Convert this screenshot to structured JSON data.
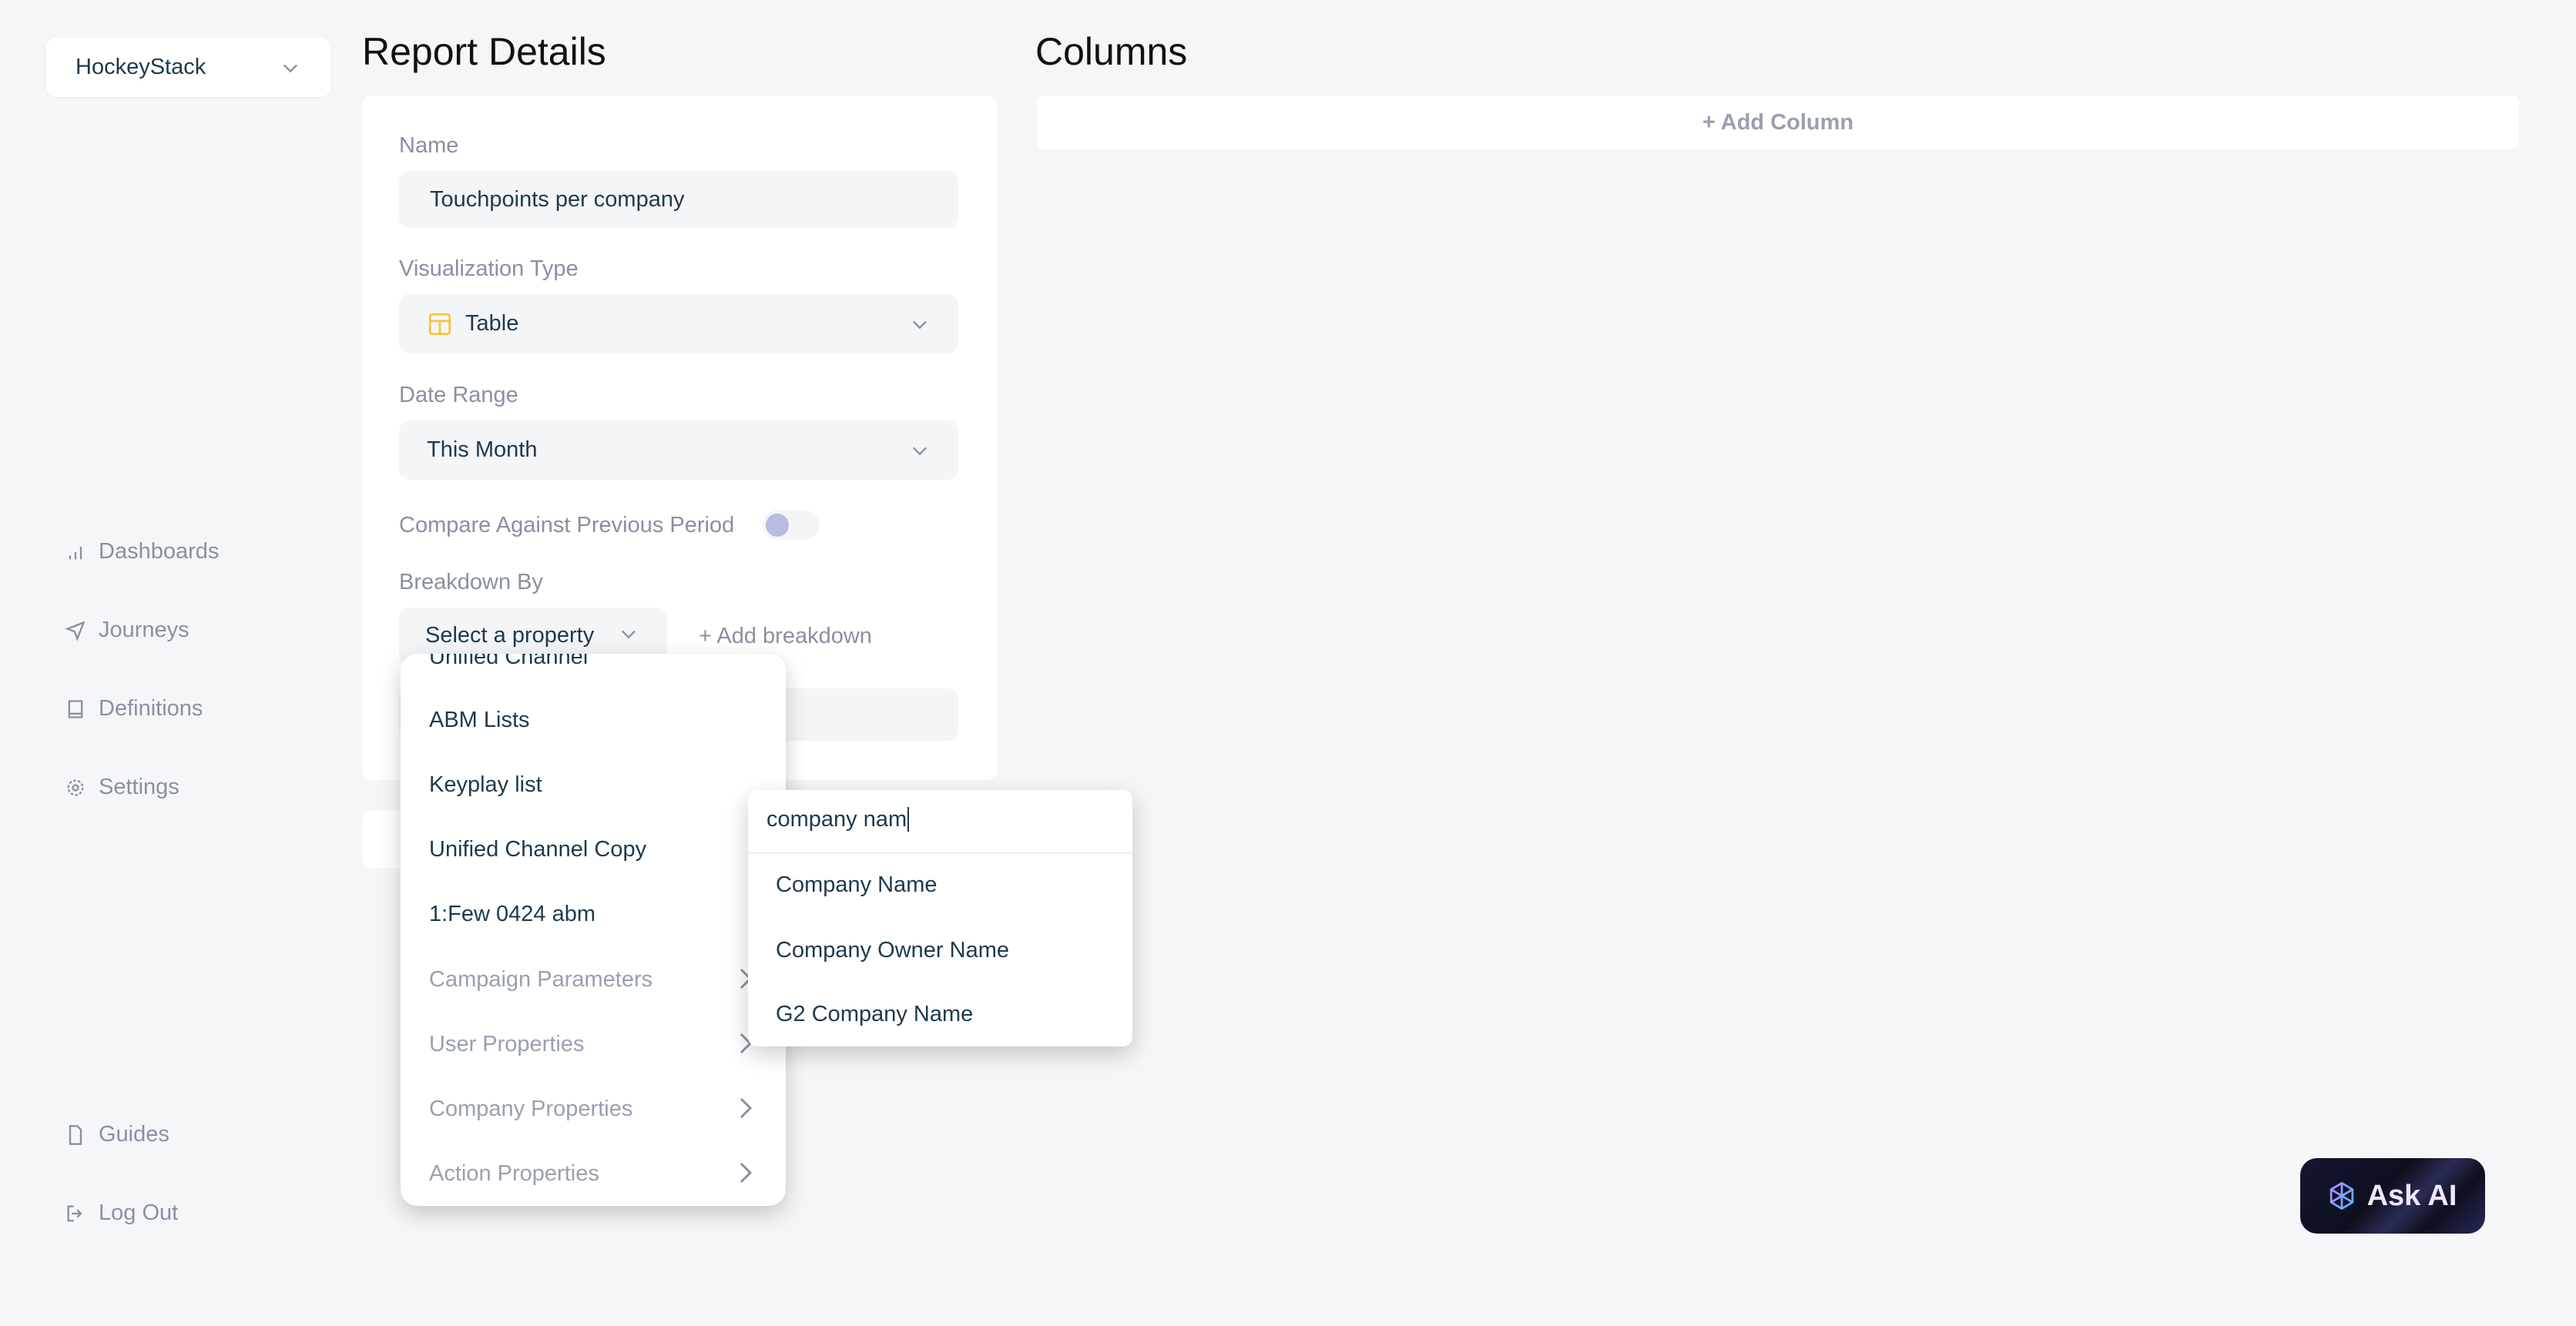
{
  "workspace": {
    "name": "HockeyStack"
  },
  "sidebar": {
    "items": [
      {
        "label": "Dashboards",
        "icon": "bar-chart-icon"
      },
      {
        "label": "Journeys",
        "icon": "send-icon"
      },
      {
        "label": "Definitions",
        "icon": "book-icon"
      },
      {
        "label": "Settings",
        "icon": "gear-icon"
      }
    ],
    "bottom": [
      {
        "label": "Guides",
        "icon": "file-icon"
      },
      {
        "label": "Log Out",
        "icon": "logout-icon"
      }
    ]
  },
  "report": {
    "title": "Report Details",
    "name_label": "Name",
    "name_value": "Touchpoints per company",
    "viz_label": "Visualization Type",
    "viz_value": "Table",
    "date_label": "Date Range",
    "date_value": "This Month",
    "compare_label": "Compare Against Previous Period",
    "compare_on": false,
    "breakdown_label": "Breakdown By",
    "breakdown_placeholder": "Select a property",
    "add_breakdown": "+ Add breakdown"
  },
  "dropdown": {
    "items": [
      {
        "label": "Unified Channel"
      },
      {
        "label": "ABM Lists"
      },
      {
        "label": "Keyplay list"
      },
      {
        "label": "Unified Channel Copy"
      },
      {
        "label": "1:Few 0424 abm"
      },
      {
        "label": "Campaign Parameters",
        "submenu": true
      },
      {
        "label": "User Properties",
        "submenu": true
      },
      {
        "label": "Company Properties",
        "submenu": true
      },
      {
        "label": "Action Properties",
        "submenu": true
      }
    ]
  },
  "submenu": {
    "search_value": "company nam",
    "results": [
      "Company Name",
      "Company Owner Name",
      "G2 Company Name"
    ]
  },
  "columns": {
    "title": "Columns",
    "add_label": "+ Add Column"
  },
  "ask_ai": {
    "label": "Ask AI"
  },
  "colors": {
    "background": "#f5f6f8",
    "text": "#1e3a4c",
    "muted": "#8a90a0",
    "table_icon": "#f5c542",
    "toggle_knob": "#b8bde0"
  }
}
